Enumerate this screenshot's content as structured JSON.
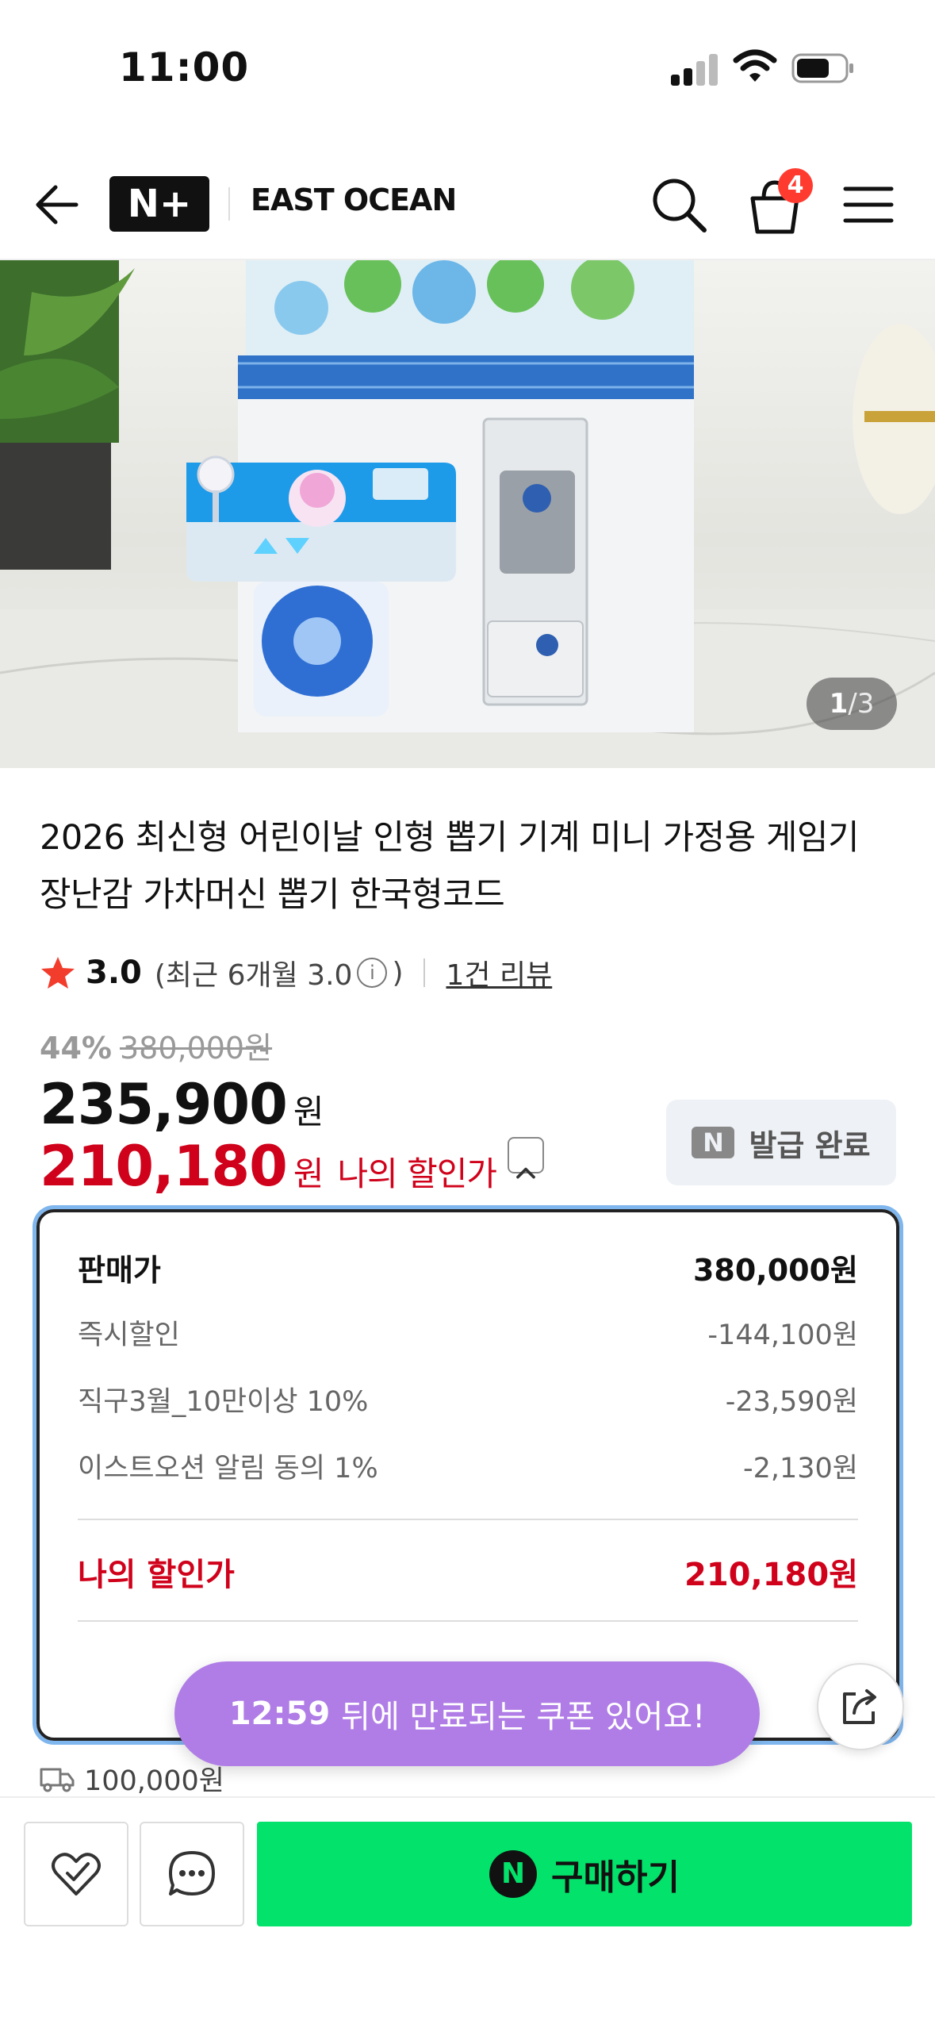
{
  "status_bar": {
    "time": "11:00"
  },
  "header": {
    "logo_text": "N+",
    "brand": "EAST OCEAN",
    "cart_count": "4"
  },
  "gallery": {
    "current": "1",
    "separator": "/",
    "total": "3"
  },
  "product": {
    "title": "2026 최신형 어린이날 인형 뽑기 기계 미니 가정용 게임기 장난감 가차머신 뽑기 한국형코드",
    "rating": "3.0",
    "rating_recent": "(최근 6개월 3.0",
    "rating_recent_close": ")",
    "info_icon_glyph": "i",
    "review_count": "1건 리뷰"
  },
  "price": {
    "discount_rate": "44%",
    "original_price": "380,000원",
    "sale_price": "235,900",
    "currency": "원",
    "my_price": "210,180",
    "my_price_label": "나의 할인가"
  },
  "coupon_button": {
    "icon": "N",
    "label": "발급 완료"
  },
  "breakdown": {
    "head": {
      "label": "판매가",
      "value": "380,000원"
    },
    "items": [
      {
        "label": "즉시할인",
        "value": "-144,100원"
      },
      {
        "label": "직구3월_10만이상 10%",
        "value": "-23,590원"
      },
      {
        "label": "이스트오션 알림 동의 1%",
        "value": "-2,130원"
      }
    ],
    "total": {
      "label": "나의 할인가",
      "value": "210,180원"
    }
  },
  "toast": {
    "timer": "12:59",
    "message": "뒤에 만료되는 쿠폰 있어요!"
  },
  "shipping": {
    "text": "100,000원"
  },
  "bottom": {
    "buy_icon": "N",
    "buy_label": "구매하기"
  },
  "colors": {
    "accent_red": "#d0021b",
    "buy_green": "#03e26a",
    "toast_purple": "#b07de6",
    "badge_red": "#ff3b30"
  }
}
